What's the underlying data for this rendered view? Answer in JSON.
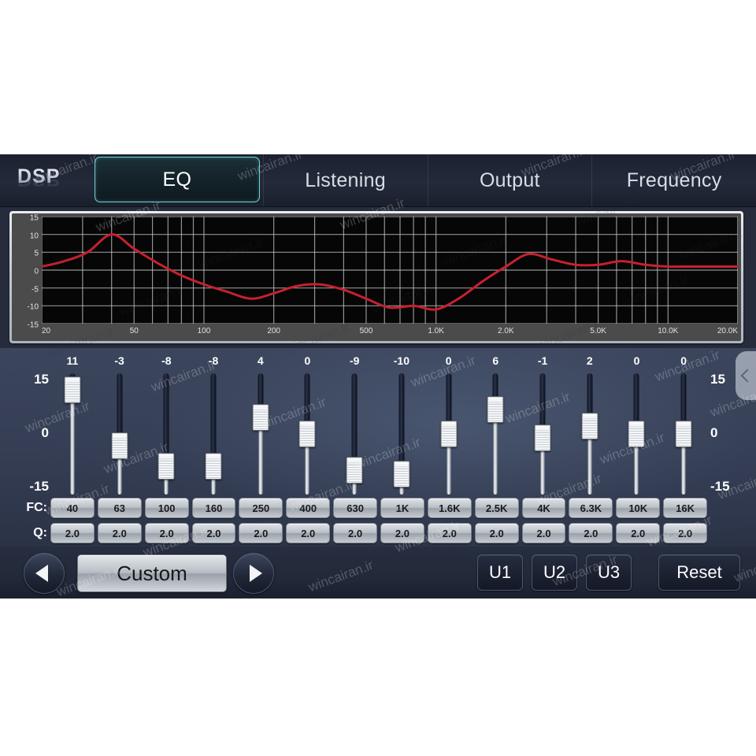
{
  "app": {
    "logo": "DSP",
    "watermark": "wincairan.ir"
  },
  "tabs": [
    {
      "label": "EQ",
      "active": true
    },
    {
      "label": "Listening",
      "active": false
    },
    {
      "label": "Output",
      "active": false
    },
    {
      "label": "Frequency",
      "active": false
    }
  ],
  "graph": {
    "y_ticks": [
      "15",
      "10",
      "5",
      "0",
      "-5",
      "-10",
      "-15"
    ],
    "x_ticks": [
      "20",
      "50",
      "100",
      "200",
      "500",
      "1.0K",
      "2.0K",
      "5.0K",
      "10.0K",
      "20.0K"
    ],
    "curve_color": "#c8202e",
    "plot_bg": "#060606",
    "grid_color": "#c9c9c9"
  },
  "chart_data": {
    "type": "line",
    "title": "",
    "xlabel": "",
    "ylabel": "",
    "xscale": "log",
    "xlim": [
      20,
      20000
    ],
    "ylim": [
      -15,
      15
    ],
    "grid": true,
    "legend": "none",
    "x": [
      20,
      25,
      31.5,
      40,
      50,
      63,
      80,
      100,
      125,
      160,
      200,
      250,
      315,
      400,
      500,
      630,
      800,
      1000,
      1250,
      1600,
      2000,
      2500,
      3150,
      4000,
      5000,
      6300,
      8000,
      10000,
      12500,
      16000,
      20000
    ],
    "y": [
      1,
      2.5,
      5,
      10,
      6,
      2,
      -1.5,
      -4,
      -6,
      -8,
      -6.5,
      -4.5,
      -4,
      -5.5,
      -8,
      -10.5,
      -10,
      -11,
      -8,
      -3,
      1,
      4.5,
      3,
      1.5,
      1.5,
      2.5,
      1.5,
      1,
      1,
      1,
      1
    ],
    "axis_ticks_x": [
      "20",
      "50",
      "100",
      "200",
      "500",
      "1.0K",
      "2.0K",
      "5.0K",
      "10.0K",
      "20.0K"
    ],
    "axis_ticks_y": [
      "15",
      "10",
      "5",
      "0",
      "-5",
      "-10",
      "-15"
    ]
  },
  "eq": {
    "scale_labels": [
      "15",
      "0",
      "-15"
    ],
    "range_min": -15,
    "range_max": 15,
    "fc_row_label": "FC:",
    "q_row_label": "Q:",
    "bands": [
      {
        "gain": "11",
        "fc": "40",
        "q": "2.0"
      },
      {
        "gain": "-3",
        "fc": "63",
        "q": "2.0"
      },
      {
        "gain": "-8",
        "fc": "100",
        "q": "2.0"
      },
      {
        "gain": "-8",
        "fc": "160",
        "q": "2.0"
      },
      {
        "gain": "4",
        "fc": "250",
        "q": "2.0"
      },
      {
        "gain": "0",
        "fc": "400",
        "q": "2.0"
      },
      {
        "gain": "-9",
        "fc": "630",
        "q": "2.0"
      },
      {
        "gain": "-10",
        "fc": "1K",
        "q": "2.0"
      },
      {
        "gain": "0",
        "fc": "1.6K",
        "q": "2.0"
      },
      {
        "gain": "6",
        "fc": "2.5K",
        "q": "2.0"
      },
      {
        "gain": "-1",
        "fc": "4K",
        "q": "2.0"
      },
      {
        "gain": "2",
        "fc": "6.3K",
        "q": "2.0"
      },
      {
        "gain": "0",
        "fc": "10K",
        "q": "2.0"
      },
      {
        "gain": "0",
        "fc": "16K",
        "q": "2.0"
      }
    ]
  },
  "bottom": {
    "prev": "◀",
    "next": "▶",
    "preset": "Custom",
    "u1": "U1",
    "u2": "U2",
    "u3": "U3",
    "reset": "Reset"
  }
}
